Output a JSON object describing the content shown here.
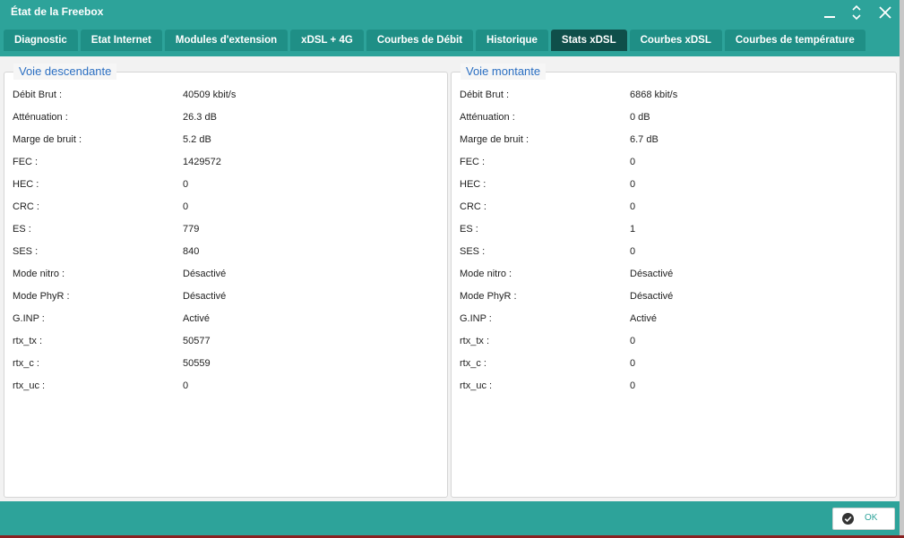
{
  "window": {
    "title": "État de la Freebox"
  },
  "tabs": [
    {
      "label": "Diagnostic"
    },
    {
      "label": "Etat Internet"
    },
    {
      "label": "Modules d'extension"
    },
    {
      "label": "xDSL + 4G"
    },
    {
      "label": "Courbes de Débit"
    },
    {
      "label": "Historique"
    },
    {
      "label": "Stats xDSL",
      "active": true
    },
    {
      "label": "Courbes xDSL"
    },
    {
      "label": "Courbes de température"
    }
  ],
  "downstream": {
    "legend": "Voie descendante",
    "rows": [
      {
        "label": "Débit Brut :",
        "value": "40509 kbit/s"
      },
      {
        "label": "Atténuation :",
        "value": "26.3 dB"
      },
      {
        "label": "Marge de bruit :",
        "value": "5.2 dB"
      },
      {
        "label": "FEC :",
        "value": "1429572"
      },
      {
        "label": "HEC :",
        "value": "0"
      },
      {
        "label": "CRC :",
        "value": "0"
      },
      {
        "label": "ES :",
        "value": "779"
      },
      {
        "label": "SES :",
        "value": "840"
      },
      {
        "label": "Mode nitro :",
        "value": "Désactivé"
      },
      {
        "label": "Mode PhyR :",
        "value": "Désactivé"
      },
      {
        "label": "G.INP :",
        "value": "Activé"
      },
      {
        "label": "rtx_tx :",
        "value": "50577"
      },
      {
        "label": "rtx_c :",
        "value": "50559"
      },
      {
        "label": "rtx_uc :",
        "value": "0"
      }
    ]
  },
  "upstream": {
    "legend": "Voie montante",
    "rows": [
      {
        "label": "Débit Brut :",
        "value": "6868 kbit/s"
      },
      {
        "label": "Atténuation :",
        "value": "0 dB"
      },
      {
        "label": "Marge de bruit :",
        "value": "6.7 dB"
      },
      {
        "label": "FEC :",
        "value": "0"
      },
      {
        "label": "HEC :",
        "value": "0"
      },
      {
        "label": "CRC :",
        "value": "0"
      },
      {
        "label": "ES :",
        "value": "1"
      },
      {
        "label": "SES :",
        "value": "0"
      },
      {
        "label": "Mode nitro :",
        "value": "Désactivé"
      },
      {
        "label": "Mode PhyR :",
        "value": "Désactivé"
      },
      {
        "label": "G.INP :",
        "value": "Activé"
      },
      {
        "label": "rtx_tx :",
        "value": "0"
      },
      {
        "label": "rtx_c :",
        "value": "0"
      },
      {
        "label": "rtx_uc :",
        "value": "0"
      }
    ]
  },
  "footer": {
    "ok_label": "OK"
  },
  "icons": {
    "minimize": "minimize-icon",
    "restore": "restore-icon",
    "close": "close-icon",
    "ok": "check-circle-icon"
  },
  "colors": {
    "accent": "#2da39a",
    "active_tab": "#0f4f4a",
    "legend_text": "#2b6fc2"
  }
}
